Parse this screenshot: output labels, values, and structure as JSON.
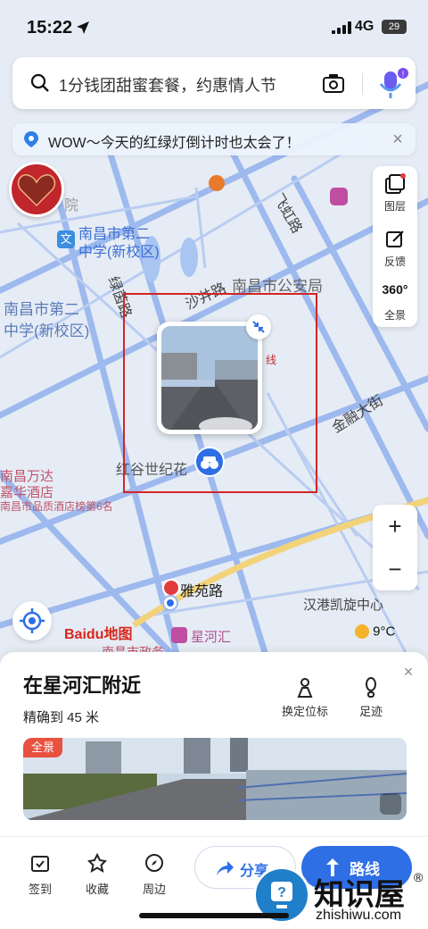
{
  "status_bar": {
    "time": "15:22",
    "network": "4G",
    "battery": "29"
  },
  "search": {
    "placeholder": "1分钱团甜蜜套餐，约惠情人节"
  },
  "notice": {
    "text": "WOW～今天的红绿灯倒计时也太会了！",
    "close": "×"
  },
  "side_tools": [
    {
      "label": "图层",
      "icon": "layers-icon"
    },
    {
      "label": "反馈",
      "icon": "feedback-icon"
    },
    {
      "label": "全景",
      "icon": "panorama-360-icon"
    }
  ],
  "panorama_badge_360": "360°",
  "zoom": {
    "in": "+",
    "out": "−"
  },
  "map_labels": {
    "school_1": "南昌市第二",
    "school_1b": "中学(新校区)",
    "school_2": "南昌市第二",
    "school_2b": "中学(新校区)",
    "road_shajing": "沙井路",
    "road_feihong": "飞虹路",
    "road_lvyin": "绿茵路",
    "police": "南昌市公安局",
    "road_jinsheng": "金融大街",
    "hongguxin": "红谷世纪花",
    "wanda_1": "南昌万达",
    "wanda_2": "嘉华酒店",
    "wanda_3": "南昌市品质酒店榜第6名",
    "yayuan": "雅苑路",
    "hanggang": "汉港凯旋中心",
    "xinghehui": "星河汇",
    "zhengwu": "南昌市政务",
    "yuan": "院",
    "xian": "线"
  },
  "baidu_logo": "Baidu地图",
  "weather": {
    "temp": "9°C"
  },
  "sheet": {
    "title": "在星河汇附近",
    "accuracy": "精确到 45 米",
    "actions": [
      {
        "label": "换定位标",
        "icon": "change-marker-icon"
      },
      {
        "label": "足迹",
        "icon": "footprint-icon"
      }
    ],
    "close": "×",
    "pano_badge": "全景"
  },
  "toolbar": {
    "items": [
      {
        "label": "签到",
        "icon": "checkin-icon"
      },
      {
        "label": "收藏",
        "icon": "star-icon"
      },
      {
        "label": "周边",
        "icon": "compass-icon"
      }
    ],
    "share": "分享",
    "route": "路线"
  },
  "watermark": {
    "title": "知识屋",
    "sub": "zhishiwu.com",
    "reg": "®"
  },
  "colors": {
    "accent": "#2f6fe6",
    "road": "#8fb0ea",
    "highlight_box": "#d32525"
  }
}
